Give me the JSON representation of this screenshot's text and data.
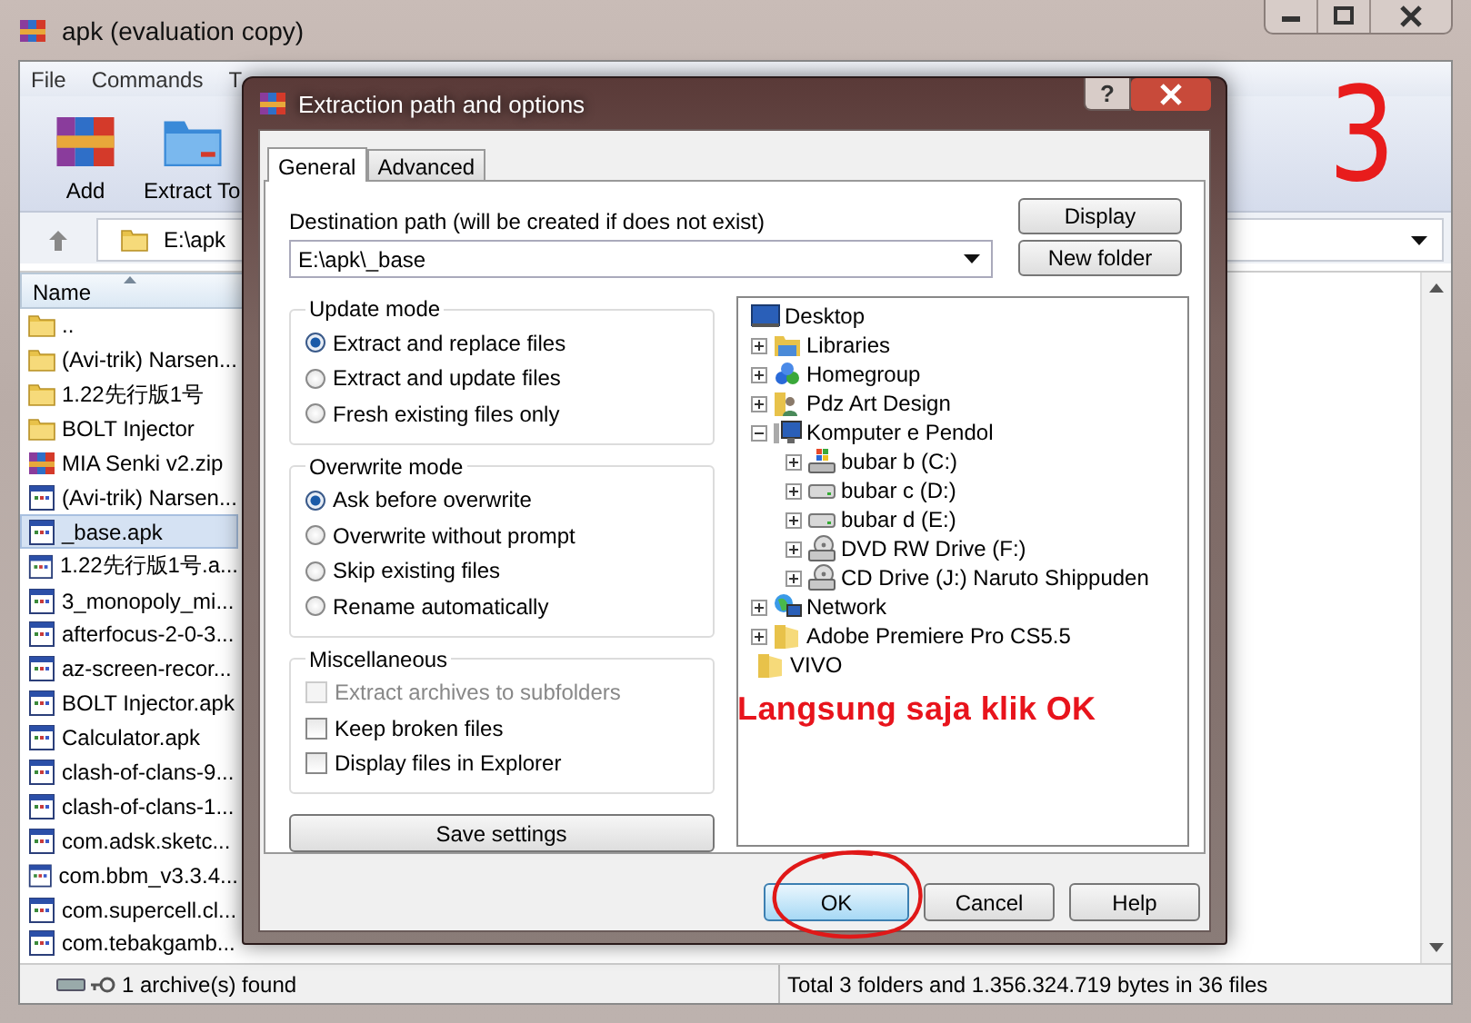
{
  "window": {
    "title": "apk (evaluation copy)"
  },
  "menu": [
    "File",
    "Commands",
    "T"
  ],
  "toolbar": [
    {
      "label": "Add",
      "kind": "archive"
    },
    {
      "label": "Extract To",
      "kind": "folder"
    }
  ],
  "address": {
    "value": "E:\\apk"
  },
  "file_list": {
    "columns": [
      "Name"
    ],
    "rows": [
      {
        "name": "..",
        "kind": "folder",
        "selected": false
      },
      {
        "name": "(Avi-trik) Narsen...",
        "kind": "folder",
        "selected": false
      },
      {
        "name": "1.22先行版1号",
        "kind": "folder",
        "selected": false
      },
      {
        "name": "BOLT Injector",
        "kind": "folder",
        "selected": false
      },
      {
        "name": "MIA Senki v2.zip",
        "kind": "archive",
        "selected": false
      },
      {
        "name": "(Avi-trik) Narsen...",
        "kind": "apk",
        "selected": false
      },
      {
        "name": "_base.apk",
        "kind": "apk",
        "selected": true
      },
      {
        "name": "1.22先行版1号.a...",
        "kind": "apk",
        "selected": false
      },
      {
        "name": "3_monopoly_mi...",
        "kind": "apk",
        "selected": false
      },
      {
        "name": "afterfocus-2-0-3...",
        "kind": "apk",
        "selected": false
      },
      {
        "name": "az-screen-recor...",
        "kind": "apk",
        "selected": false
      },
      {
        "name": "BOLT Injector.apk",
        "kind": "apk",
        "selected": false
      },
      {
        "name": "Calculator.apk",
        "kind": "apk",
        "selected": false
      },
      {
        "name": "clash-of-clans-9...",
        "kind": "apk",
        "selected": false
      },
      {
        "name": "clash-of-clans-1...",
        "kind": "apk",
        "selected": false
      },
      {
        "name": "com.adsk.sketc...",
        "kind": "apk",
        "selected": false
      },
      {
        "name": "com.bbm_v3.3.4...",
        "kind": "apk",
        "selected": false
      },
      {
        "name": "com.supercell.cl...",
        "kind": "apk",
        "selected": false
      },
      {
        "name": "com.tebakgamb...",
        "kind": "apk",
        "selected": false
      }
    ]
  },
  "status_bar": [
    "1 archive(s) found",
    "Total 3 folders and 1.356.324.719 bytes in 36 files"
  ],
  "dialog": {
    "title": "Extraction path and options",
    "help": "?",
    "tabs": [
      {
        "label": "General",
        "selected": true
      },
      {
        "label": "Advanced",
        "selected": false
      }
    ],
    "destination_label": "Destination path (will be created if does not exist)",
    "destination_value": "E:\\apk\\_base",
    "side_buttons": [
      "Display",
      "New folder"
    ],
    "update_mode": {
      "title": "Update mode",
      "options": [
        {
          "label": "Extract and replace files",
          "selected": true
        },
        {
          "label": "Extract and update files",
          "selected": false
        },
        {
          "label": "Fresh existing files only",
          "selected": false
        }
      ]
    },
    "overwrite_mode": {
      "title": "Overwrite mode",
      "options": [
        {
          "label": "Ask before overwrite",
          "selected": true
        },
        {
          "label": "Overwrite without prompt",
          "selected": false
        },
        {
          "label": "Skip existing files",
          "selected": false
        },
        {
          "label": "Rename automatically",
          "selected": false
        }
      ]
    },
    "miscellaneous": {
      "title": "Miscellaneous",
      "options": [
        {
          "label": "Extract archives to subfolders",
          "checked": false,
          "disabled": true
        },
        {
          "label": "Keep broken files",
          "checked": false,
          "disabled": false
        },
        {
          "label": "Display files in Explorer",
          "checked": false,
          "disabled": false
        }
      ]
    },
    "save_button": "Save settings",
    "tree": [
      {
        "label": "Desktop",
        "kind": "desktop",
        "children": [
          {
            "label": "Libraries",
            "kind": "library",
            "expanded": false
          },
          {
            "label": "Homegroup",
            "kind": "homegroup",
            "expanded": false
          },
          {
            "label": "Pdz Art Design",
            "kind": "user-folder",
            "expanded": false
          },
          {
            "label": "Komputer e Pendol",
            "kind": "computer",
            "expanded": true,
            "children": [
              {
                "label": "bubar b (C:)",
                "kind": "system-drive",
                "expanded": false
              },
              {
                "label": "bubar c (D:)",
                "kind": "drive",
                "expanded": false
              },
              {
                "label": "bubar d (E:)",
                "kind": "drive",
                "expanded": false
              },
              {
                "label": "DVD RW Drive (F:)",
                "kind": "optical-drive",
                "expanded": false
              },
              {
                "label": "CD Drive (J:) Naruto Shippuden",
                "kind": "optical-drive",
                "expanded": false
              }
            ]
          },
          {
            "label": "Network",
            "kind": "network",
            "expanded": false
          },
          {
            "label": "Adobe Premiere Pro CS5.5",
            "kind": "folder",
            "expanded": false
          },
          {
            "label": "VIVO",
            "kind": "folder"
          }
        ]
      }
    ],
    "buttons": [
      {
        "label": "OK",
        "default": true
      },
      {
        "label": "Cancel",
        "default": false
      },
      {
        "label": "Help",
        "default": false
      }
    ]
  },
  "annotations": [
    {
      "kind": "number",
      "text": "3"
    },
    {
      "kind": "note",
      "text": "Langsung saja klik OK"
    }
  ]
}
